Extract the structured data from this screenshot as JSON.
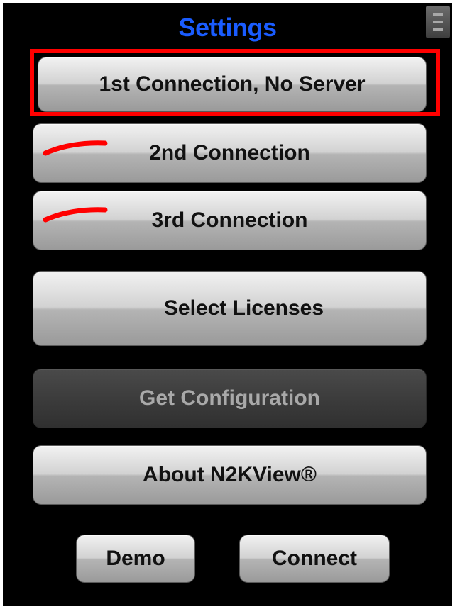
{
  "title": "Settings",
  "menu_icon": "hamburger-menu-icon",
  "buttons": {
    "connection1": "1st Connection, No Server",
    "connection2": "2nd Connection",
    "connection3": "3rd Connection",
    "licenses": "Select Licenses",
    "config": "Get Configuration",
    "about": "About N2KView®",
    "demo": "Demo",
    "connect": "Connect"
  },
  "connection_status": {
    "connection2": "inactive-red-mark",
    "connection3": "inactive-red-mark"
  },
  "colors": {
    "title": "#1a5cff",
    "highlight": "#ff0000",
    "status_mark": "#ff0000",
    "background": "#000000",
    "disabled_text": "#a9a9a9"
  }
}
